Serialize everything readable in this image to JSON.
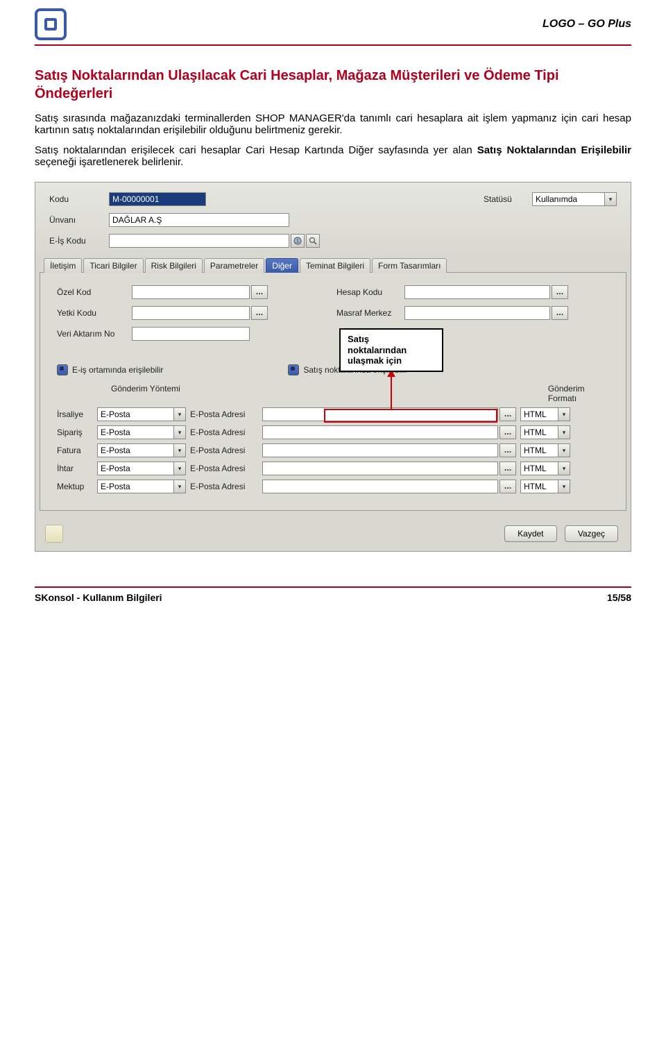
{
  "header": {
    "brand": "LOGO – GO Plus"
  },
  "doc": {
    "title": "Satış Noktalarından Ulaşılacak Cari Hesaplar, Mağaza Müşterileri ve Ödeme Tipi Öndeğerleri",
    "p1": "Satış sırasında mağazanızdaki terminallerden SHOP MANAGER'da tanımlı cari hesaplara ait işlem yapmanız için cari hesap kartının satış noktalarından erişilebilir olduğunu belirtmeniz gerekir.",
    "p2a": "Satış noktalarından erişilecek cari hesaplar Cari Hesap Kartında Diğer sayfasında yer alan ",
    "p2b": "Satış Noktalarından Erişilebilir",
    "p2c": " seçeneği işaretlenerek belirlenir."
  },
  "form": {
    "labels": {
      "kodu": "Kodu",
      "statusu": "Statüsü",
      "unvani": "Ünvanı",
      "eiskodu": "E-İş Kodu"
    },
    "values": {
      "kodu": "M-00000001",
      "statusu": "Kullanımda",
      "unvani": "DAĞLAR A.Ş",
      "eiskodu": ""
    },
    "tabs": [
      "İletişim",
      "Ticari Bilgiler",
      "Risk Bilgileri",
      "Parametreler",
      "Diğer",
      "Teminat Bilgileri",
      "Form Tasarımları"
    ],
    "active_tab": "Diğer",
    "diger": {
      "labels": {
        "ozel_kod": "Özel Kod",
        "yetki_kodu": "Yetki Kodu",
        "veri_aktarim_no": "Veri Aktarım No",
        "hesap_kodu": "Hesap Kodu",
        "masraf_merkez": "Masraf Merkez"
      },
      "check1": "E-iş ortamında erişilebilir",
      "check2": "Satış noktalarında erişilebilir",
      "grid_headers": {
        "yontem": "Gönderim Yöntemi",
        "format": "Gönderim Formatı"
      },
      "rows": [
        "İrsaliye",
        "Sipariş",
        "Fatura",
        "İhtar",
        "Mektup"
      ],
      "method_value": "E-Posta",
      "eposta_adresi": "E-Posta Adresi",
      "format_value": "HTML"
    },
    "buttons": {
      "kaydet": "Kaydet",
      "vazgec": "Vazgeç"
    }
  },
  "callout": {
    "line1": "Satış",
    "line2": "noktalarından",
    "line3": "ulaşmak için"
  },
  "footer": {
    "left": "SKonsol - Kullanım Bilgileri",
    "page": "15/58"
  }
}
